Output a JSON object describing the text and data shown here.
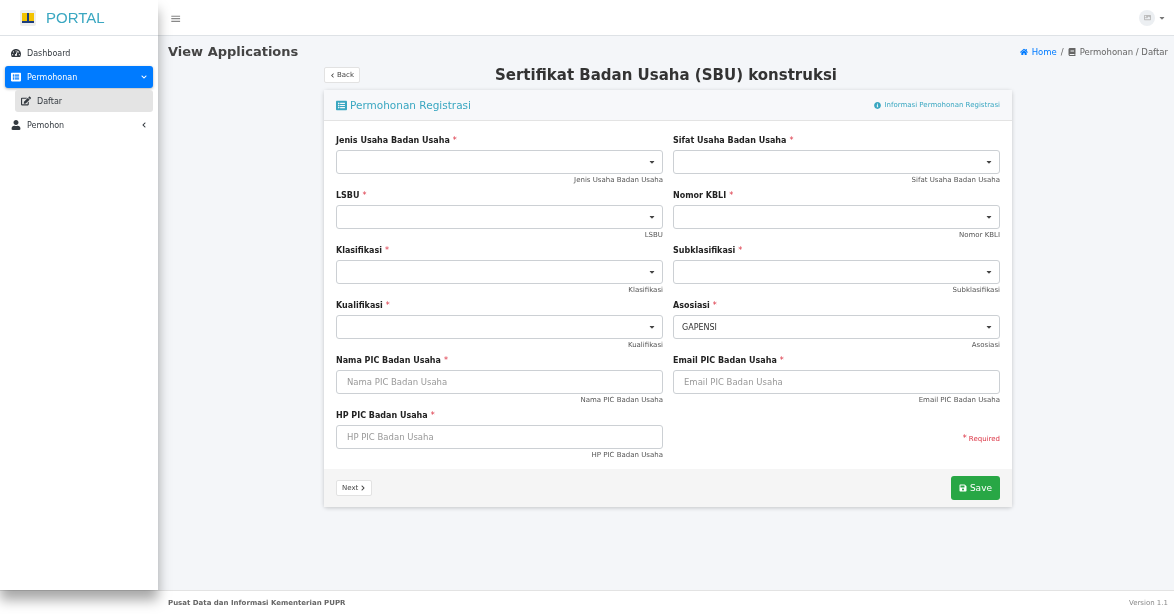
{
  "brand": {
    "title": "PORTAL"
  },
  "topbar": {
    "menu_glyph": "≡"
  },
  "sidebar": {
    "items": [
      {
        "kind": "link",
        "label": "Dashboard",
        "selected": false
      },
      {
        "kind": "group",
        "label": "Permohonan",
        "selected": true,
        "expanded": true,
        "children": [
          {
            "label": "Daftar",
            "selected": true
          }
        ]
      },
      {
        "kind": "group",
        "label": "Pemohon",
        "selected": false,
        "expanded": false
      }
    ]
  },
  "page": {
    "title": "View Applications",
    "separator": "/",
    "breadcrumb": [
      {
        "label": "Home",
        "link": true
      },
      {
        "label": "Permohonan / Daftar",
        "link": false
      }
    ]
  },
  "back_button": "Back",
  "heading": "Sertifikat Badan Usaha (SBU) konstruksi",
  "card": {
    "title": "Permohonan Registrasi",
    "info_link": "Informasi Permohonan Registrasi",
    "required_mark": "*",
    "fields": [
      {
        "kind": "select",
        "label": "Jenis Usaha Badan Usaha",
        "required": true,
        "help": "Jenis Usaha Badan Usaha"
      },
      {
        "kind": "select",
        "label": "Sifat Usaha Badan Usaha",
        "required": true,
        "help": "Sifat Usaha Badan Usaha"
      },
      {
        "kind": "select",
        "label": "LSBU",
        "required": true,
        "help": "LSBU"
      },
      {
        "kind": "select",
        "label": "Nomor KBLI",
        "required": true,
        "help": "Nomor KBLI"
      },
      {
        "kind": "select",
        "label": "Klasifikasi",
        "required": true,
        "help": "Klasifikasi"
      },
      {
        "kind": "select",
        "label": "Subklasifikasi",
        "required": true,
        "help": "Subklasifikasi"
      },
      {
        "kind": "select",
        "label": "Kualifikasi",
        "required": true,
        "help": "Kualifikasi"
      },
      {
        "kind": "select",
        "label": "Asosiasi",
        "required": true,
        "value": "GAPENSI",
        "help": "Asosiasi"
      },
      {
        "kind": "text",
        "label": "Nama PIC Badan Usaha",
        "required": true,
        "placeholder": "Nama PIC Badan Usaha",
        "help": "Nama PIC Badan Usaha"
      },
      {
        "kind": "text",
        "label": "Email PIC Badan Usaha",
        "required": true,
        "placeholder": "Email PIC Badan Usaha",
        "help": "Email PIC Badan Usaha"
      },
      {
        "kind": "text",
        "label": "HP PIC Badan Usaha",
        "required": true,
        "placeholder": "HP PIC Badan Usaha",
        "help": "HP PIC Badan Usaha"
      }
    ],
    "required_note": "Required",
    "next_button": "Next",
    "save_button": "Save"
  },
  "footer": {
    "left": "Pusat Data dan Informasi Kementerian PUPR",
    "right": "Version 1.1"
  }
}
